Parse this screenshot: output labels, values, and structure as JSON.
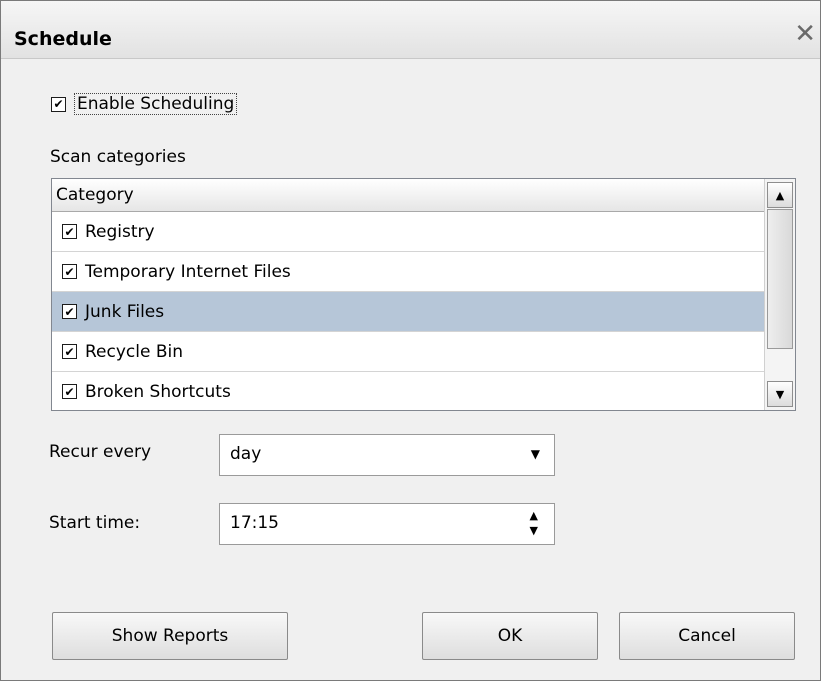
{
  "window": {
    "title": "Schedule",
    "close_glyph": "✕"
  },
  "enable": {
    "label": "Enable Scheduling",
    "checked": true
  },
  "scan": {
    "section_label": "Scan categories",
    "column_header": "Category",
    "rows": [
      {
        "label": "Registry",
        "checked": true,
        "selected": false
      },
      {
        "label": "Temporary Internet Files",
        "checked": true,
        "selected": false
      },
      {
        "label": "Junk Files",
        "checked": true,
        "selected": true
      },
      {
        "label": "Recycle Bin",
        "checked": true,
        "selected": false
      },
      {
        "label": "Broken Shortcuts",
        "checked": true,
        "selected": false
      }
    ]
  },
  "recur": {
    "label": "Recur every",
    "value": "day"
  },
  "start": {
    "label": "Start time:",
    "value": "17:15"
  },
  "buttons": {
    "show_reports": "Show Reports",
    "ok": "OK",
    "cancel": "Cancel"
  },
  "icons": {
    "check": "check-icon",
    "close": "close-icon",
    "dropdown": "chevron-down-icon",
    "spinner": "spinner-icon"
  },
  "colors": {
    "selected_row": "#b6c6d8",
    "dialog_bg": "#f0f0f0"
  }
}
